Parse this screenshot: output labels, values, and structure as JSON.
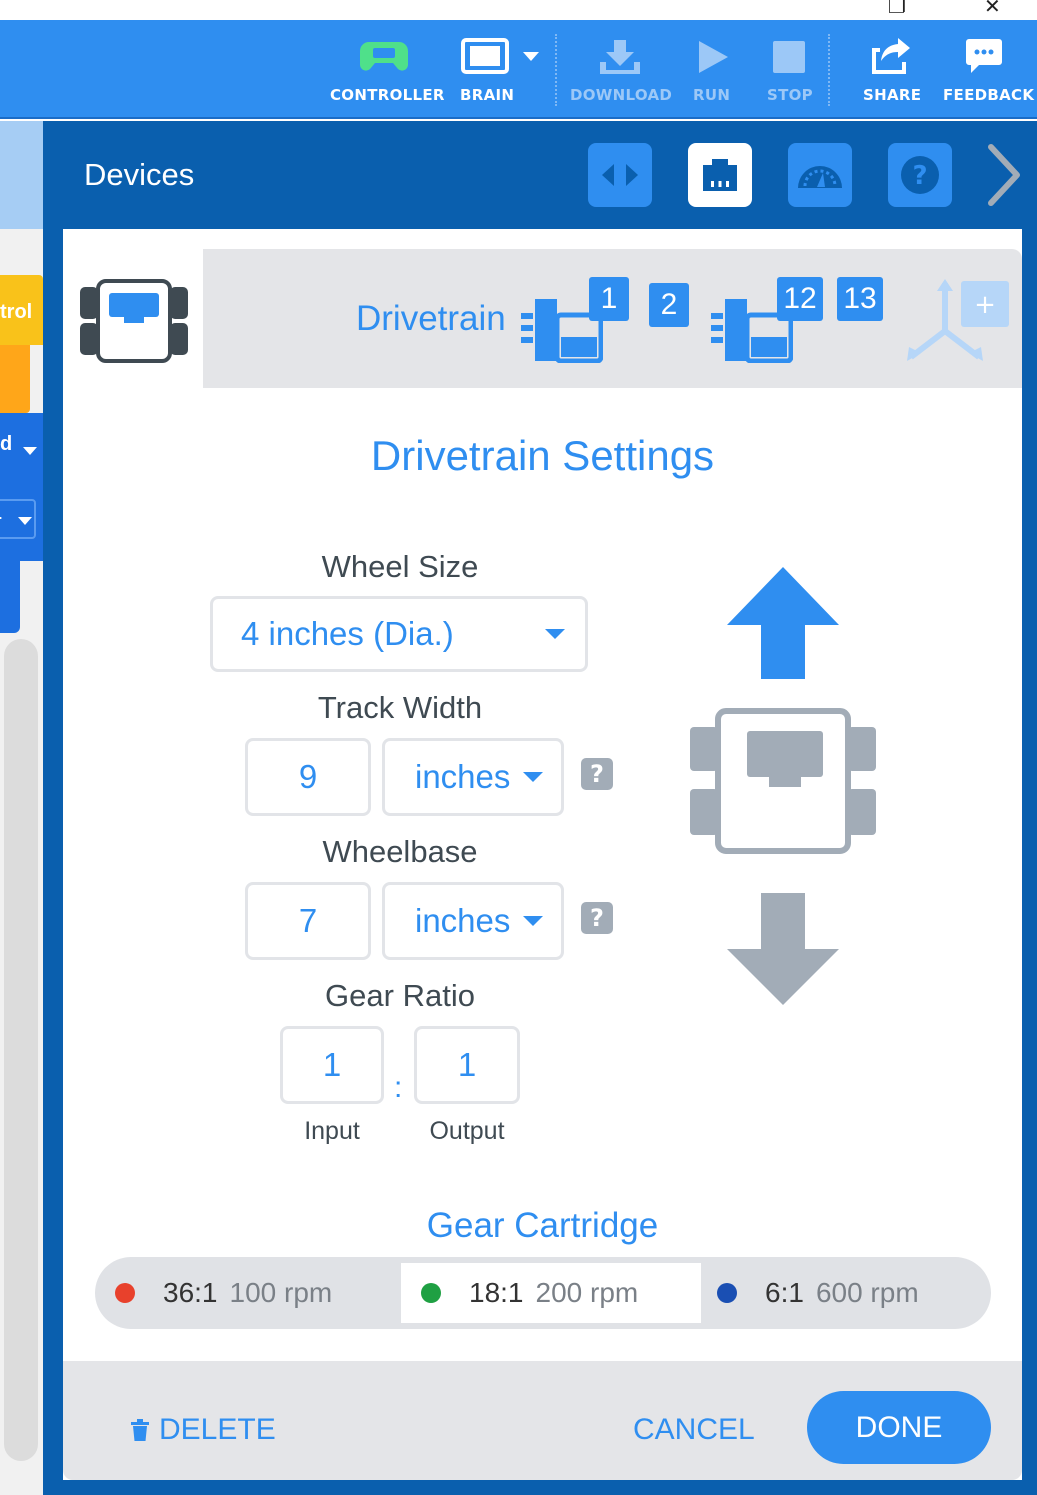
{
  "window": {
    "restore_glyph": "❐",
    "close_glyph": "✕"
  },
  "toolbar": {
    "controller": "CONTROLLER",
    "brain": "BRAIN",
    "download": "DOWNLOAD",
    "run": "RUN",
    "stop": "STOP",
    "share": "SHARE",
    "feedback": "FEEDBACK"
  },
  "header": {
    "title": "Devices",
    "help_glyph": "?"
  },
  "sidebar_fragments": {
    "control_text": "trol",
    "dropdown1_text": "d",
    "dropdown2_text": "."
  },
  "device": {
    "name": "Drivetrain",
    "ports_left": [
      "1",
      "2"
    ],
    "ports_right": [
      "12",
      "13"
    ],
    "add_glyph": "+"
  },
  "settings": {
    "title": "Drivetrain Settings",
    "wheel_size_label": "Wheel Size",
    "wheel_size_value": "4 inches (Dia.)",
    "track_width_label": "Track Width",
    "track_width_value": "9",
    "track_width_unit": "inches",
    "wheelbase_label": "Wheelbase",
    "wheelbase_value": "7",
    "wheelbase_unit": "inches",
    "help_glyph": "?",
    "gear_ratio_label": "Gear Ratio",
    "gear_input_value": "1",
    "gear_output_value": "1",
    "gear_separator": ":",
    "input_label": "Input",
    "output_label": "Output",
    "cartridge_title": "Gear Cartridge",
    "cartridges": [
      {
        "ratio": "36:1",
        "rpm": "100 rpm",
        "color": "#e8412c",
        "selected": false
      },
      {
        "ratio": "18:1",
        "rpm": "200 rpm",
        "color": "#1fa043",
        "selected": true
      },
      {
        "ratio": "6:1",
        "rpm": "600 rpm",
        "color": "#1a4fb3",
        "selected": false
      }
    ]
  },
  "footer": {
    "delete": "DELETE",
    "cancel": "CANCEL",
    "done": "DONE"
  },
  "colors": {
    "accent": "#2f8ef0",
    "header_dark": "#0a5fae",
    "controller_green": "#4fe08a",
    "control_yellow": "#f9c21a",
    "gray_icon": "#a2acb7"
  }
}
